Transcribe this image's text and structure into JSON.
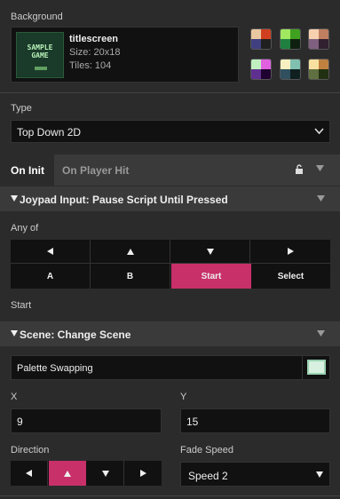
{
  "background": {
    "label": "Background",
    "title": "titlescreen",
    "size": "Size:  20x18",
    "tiles": "Tiles:  104",
    "thumb_text_1": "SAMPLE",
    "thumb_text_2": "GAME",
    "palettes": [
      {
        "colors": [
          "#e8c8a0",
          "#d04020",
          "#404080",
          "#202020"
        ]
      },
      {
        "colors": [
          "#a0e860",
          "#40a020",
          "#208040",
          "#102010"
        ]
      },
      {
        "colors": [
          "#f8d0b0",
          "#c08060",
          "#806080",
          "#302030"
        ]
      },
      {
        "colors": [
          "#c0f0c0",
          "#e060e0",
          "#603090",
          "#200030"
        ]
      },
      {
        "colors": [
          "#f8f0c0",
          "#80c0b0",
          "#305060",
          "#102020"
        ]
      },
      {
        "colors": [
          "#f8e0a0",
          "#c08040",
          "#607040",
          "#203010"
        ]
      }
    ]
  },
  "type": {
    "label": "Type",
    "value": "Top Down 2D"
  },
  "tabs": {
    "on_init": "On Init",
    "on_player_hit": "On Player Hit"
  },
  "joypad": {
    "title": "Joypad Input: Pause Script Until Pressed",
    "any_of_label": "Any of",
    "buttons_row2": [
      "A",
      "B",
      "Start",
      "Select"
    ],
    "selected": "Start"
  },
  "start_label": "Start",
  "scene": {
    "title": "Scene: Change Scene",
    "scene_value": "Palette Swapping",
    "x_label": "X",
    "x_value": "9",
    "y_label": "Y",
    "y_value": "15",
    "direction_label": "Direction",
    "fade_label": "Fade Speed",
    "fade_value": "Speed 2"
  },
  "colors": {
    "accent": "#c8306a",
    "panel": "#2b2b2b",
    "field": "#111111"
  }
}
